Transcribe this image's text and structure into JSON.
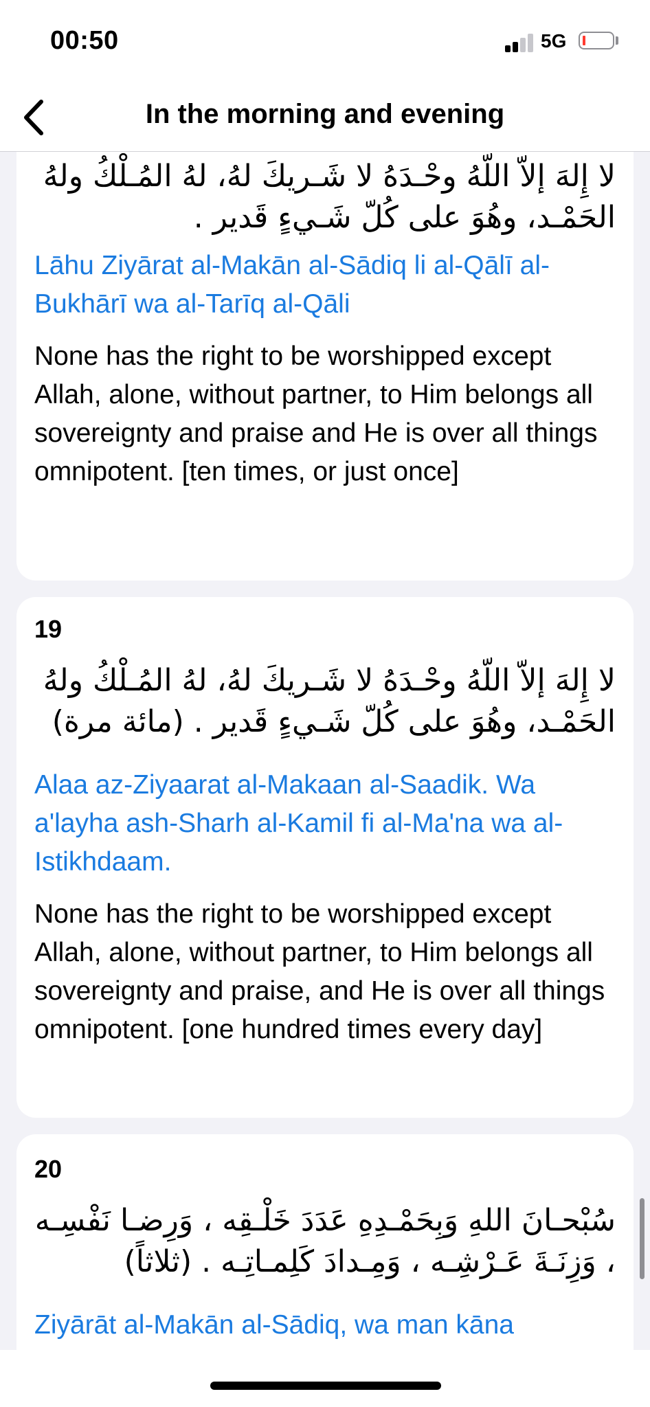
{
  "status_bar": {
    "time": "00:50",
    "network": "5G",
    "icons": [
      "signal-bars-icon",
      "battery-low-icon"
    ],
    "battery_color": "#ff3b30"
  },
  "nav": {
    "back_icon": "chevron-left-icon",
    "title": "In the morning and evening"
  },
  "colors": {
    "transliteration": "#1a7be0",
    "card_background": "#ffffff",
    "page_background": "#f2f2f7"
  },
  "cards": [
    {
      "number": "",
      "arabic": "لا إِلهَ إلاّ اللّهُ وحْـدَهُ لا شَـريكَ لهُ، لهُ المُـلْكُ ولهُ الحَمْـد، وهُوَ على كُلّ شَـيءٍ قَدير .",
      "transliteration": "Lāhu Ziyārat al-Makān al-Sādiq li al-Qālī al-Bukhārī wa al-Tarīq al-Qāli",
      "translation": "None has the right to be worshipped except Allah, alone, without partner, to Him belongs all sovereignty and praise and He is over all things omnipotent. [ten times, or just once]"
    },
    {
      "number": "19",
      "arabic": "لا إِلهَ إلاّ اللّهُ وحْـدَهُ لا شَـريكَ لهُ، لهُ المُـلْكُ ولهُ الحَمْـد، وهُوَ على كُلّ شَـيءٍ قَدير . (مائة مرة)",
      "transliteration": "Alaa az-Ziyaarat al-Makaan al-Saadik. Wa a'layha ash-Sharh al-Kamil fi al-Ma'na wa al-Istikhdaam.",
      "translation": "None has the right to be worshipped except Allah, alone, without partner, to Him belongs all sovereignty and praise, and He is over all things omnipotent. [one hundred times every day]"
    },
    {
      "number": "20",
      "arabic": "سُبْحـانَ اللهِ وَبِحَمْـدِهِ عَدَدَ خَلْـقِه ، وَرِضـا نَفْسِـه ، وَزِنَـةَ عَـرْشِـه ، وَمِـدادَ كَلِمـاتِـه . (ثلاثاً)",
      "transliteration": "Ziyārāt al-Makān al-Sādiq, wa man kāna",
      "translation": ""
    }
  ]
}
